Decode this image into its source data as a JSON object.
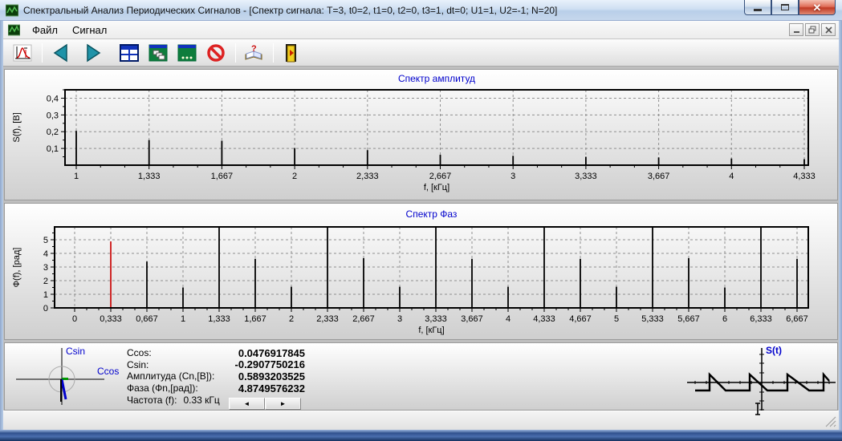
{
  "window": {
    "title": "Спектральный Анализ Периодических Сигналов - [Спектр сигнала: T=3, t0=2, t1=0, t2=0, t3=1, dt=0; U1=1, U2=-1; N=20]"
  },
  "menu": {
    "items": [
      "Файл",
      "Сигнал"
    ]
  },
  "toolbar": {
    "items": [
      "spectrum-plot",
      "nav-back",
      "nav-forward",
      "table-view",
      "cascade-windows",
      "signal-view",
      "stop",
      "help-book",
      "exit-door"
    ]
  },
  "chart_data": [
    {
      "type": "bar",
      "title": "Спектр амплитуд",
      "xlabel": "f, [кГц]",
      "ylabel": "S(f), [В]",
      "x": [
        1,
        1.333,
        1.667,
        2,
        2.333,
        2.667,
        3,
        3.333,
        3.667,
        4,
        4.333
      ],
      "xtick_labels": [
        "1",
        "1,333",
        "1,667",
        "2",
        "2,333",
        "2,667",
        "3",
        "3,333",
        "3,667",
        "4",
        "4,333"
      ],
      "values": [
        0.205,
        0.15,
        0.146,
        0.102,
        0.09,
        0.062,
        0.056,
        0.05,
        0.046,
        0.04,
        0.036
      ],
      "yticks": [
        0.1,
        0.2,
        0.3,
        0.4
      ],
      "ytick_labels": [
        "0,1",
        "0,2",
        "0,3",
        "0,4"
      ],
      "ylim": [
        0,
        0.45
      ],
      "grid": true,
      "bar_color": "#000000",
      "title_color": "#0000cc"
    },
    {
      "type": "bar",
      "title": "Спектр Фаз",
      "xlabel": "f, [кГц]",
      "ylabel": "Ф(f), [рад]",
      "x": [
        0,
        0.333,
        0.667,
        1,
        1.333,
        1.667,
        2,
        2.333,
        2.667,
        3,
        3.333,
        3.667,
        4,
        4.333,
        4.667,
        5,
        5.333,
        5.667,
        6,
        6.333,
        6.667
      ],
      "xtick_labels": [
        "0",
        "0,333",
        "0,667",
        "1",
        "1,333",
        "1,667",
        "2",
        "2,333",
        "2,667",
        "3",
        "3,333",
        "3,667",
        "4",
        "4,333",
        "4,667",
        "5",
        "5,333",
        "5,667",
        "6",
        "6,333",
        "6,667"
      ],
      "values": [
        null,
        4.875,
        3.4,
        1.5,
        5.94,
        3.6,
        1.55,
        5.94,
        3.65,
        1.55,
        5.94,
        3.6,
        1.55,
        5.94,
        3.6,
        1.55,
        5.94,
        3.65,
        1.5,
        5.94,
        3.6
      ],
      "yticks": [
        0,
        1,
        2,
        3,
        4,
        5
      ],
      "ytick_labels": [
        "0",
        "1",
        "2",
        "3",
        "4",
        "5"
      ],
      "ylim": [
        0,
        5.94
      ],
      "grid": true,
      "bar_color": "#000000",
      "selected_index": 1,
      "selected_color": "#cc1111",
      "title_color": "#0000cc"
    }
  ],
  "info_panel": {
    "phasor": {
      "y_axis_label": "Csin",
      "x_axis_label": "Ccos"
    },
    "rows": [
      {
        "label": "Ccos:",
        "value": "0.0476917845"
      },
      {
        "label": "Csin:",
        "value": "-0.2907750216"
      },
      {
        "label": "Амплитуда (Cn,[В]):",
        "value": "0.5893203525"
      },
      {
        "label": "Фаза (Фn,[рад]):",
        "value": "4.8749576232"
      }
    ],
    "frequency": {
      "label": "Частота (f):",
      "value": "0.33 кГц"
    },
    "spinner": {
      "prev": "◄",
      "next": "►"
    }
  },
  "signal_preview": {
    "label": "S(t)"
  },
  "colors": {
    "chart_title": "#0000cc",
    "bar": "#000000",
    "selected_bar": "#cc1111"
  }
}
